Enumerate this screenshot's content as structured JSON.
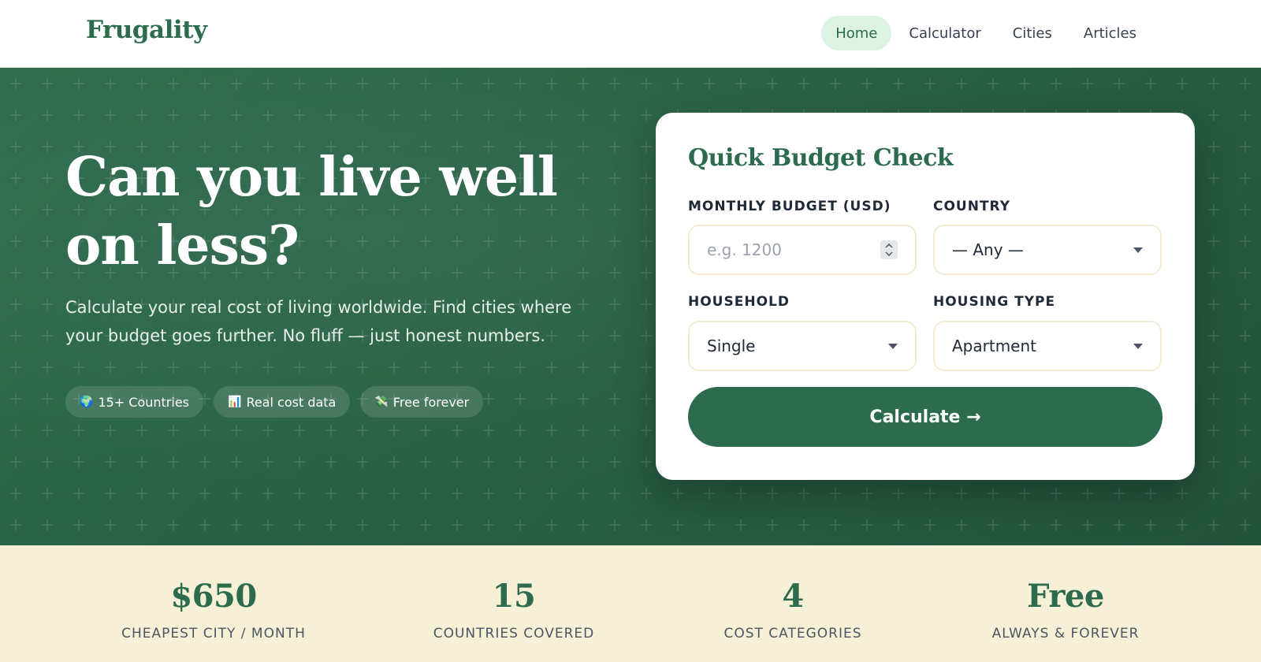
{
  "brand": {
    "name": "Frugality",
    "color": "#2c6b4d"
  },
  "nav": {
    "items": [
      {
        "label": "Home",
        "active": true
      },
      {
        "label": "Calculator",
        "active": false
      },
      {
        "label": "Cities",
        "active": false
      },
      {
        "label": "Articles",
        "active": false
      }
    ]
  },
  "hero": {
    "title": "Can you live well on less?",
    "subtitle": "Calculate your real cost of living worldwide. Find cities where your budget goes further. No fluff — just honest numbers.",
    "chips": [
      {
        "icon": "globe-icon",
        "emoji": "🌍",
        "label": "15+ Countries"
      },
      {
        "icon": "chart-icon",
        "emoji": "📊",
        "label": "Real cost data"
      },
      {
        "icon": "money-icon",
        "emoji": "💸",
        "label": "Free forever"
      }
    ]
  },
  "budget_form": {
    "title": "Quick Budget Check",
    "monthly_budget": {
      "label": "MONTHLY BUDGET (USD)",
      "placeholder": "e.g. 1200",
      "value": ""
    },
    "country": {
      "label": "COUNTRY",
      "value": "— Any —"
    },
    "household": {
      "label": "HOUSEHOLD",
      "value": "Single"
    },
    "housing_type": {
      "label": "HOUSING TYPE",
      "value": "Apartment"
    },
    "submit_label": "Calculate →"
  },
  "stats": [
    {
      "value": "$650",
      "label": "CHEAPEST CITY / MONTH"
    },
    {
      "value": "15",
      "label": "COUNTRIES COVERED"
    },
    {
      "value": "4",
      "label": "COST CATEGORIES"
    },
    {
      "value": "Free",
      "label": "ALWAYS & FOREVER"
    }
  ],
  "colors": {
    "primary": "#2c6b4d",
    "hero_bg": "#2d6b4d",
    "nav_active_bg": "#dcf2e3",
    "stats_bg": "#f6f0d6",
    "field_border": "#f3ecd2"
  }
}
